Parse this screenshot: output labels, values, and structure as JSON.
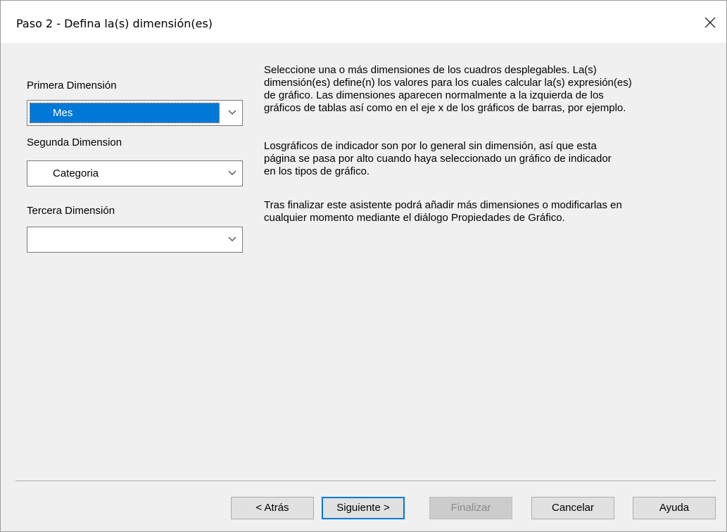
{
  "window": {
    "title": "Paso 2 - Defina la(s) dimensión(es)",
    "close_icon": "close-icon"
  },
  "dimensions": {
    "first": {
      "label": "Primera Dimensión",
      "value": "Mes"
    },
    "second": {
      "label": "Segunda Dimension",
      "value": "Categoria"
    },
    "third": {
      "label": "Tercera Dimensión",
      "value": ""
    }
  },
  "description": {
    "paragraph1": [
      "Seleccione una o más dimensiones de los cuadros desplegables. La(s)",
      "dimensión(es) define(n) los valores para los cuales calcular la(s) expresión(es)",
      "de gráfico. Las dimensiones aparecen normalmente a la izquierda de los",
      "gráficos de tablas así como en el eje x de los gráficos de barras, por ejemplo."
    ],
    "paragraph2": [
      "Losgráficos de indicador son por lo general sin dimensión, así que esta",
      "página se pasa por alto cuando haya seleccionado un gráfico de indicador",
      "en los tipos de gráfico."
    ],
    "paragraph3": [
      "Tras finalizar este asistente podrá añadir más dimensiones o modificarlas en",
      "cualquier momento mediante el diálogo Propiedades de Gráfico."
    ]
  },
  "buttons": {
    "back": "< Atrás",
    "next": "Siguiente >",
    "finish": "Finalizar",
    "cancel": "Cancelar",
    "help": "Ayuda"
  }
}
